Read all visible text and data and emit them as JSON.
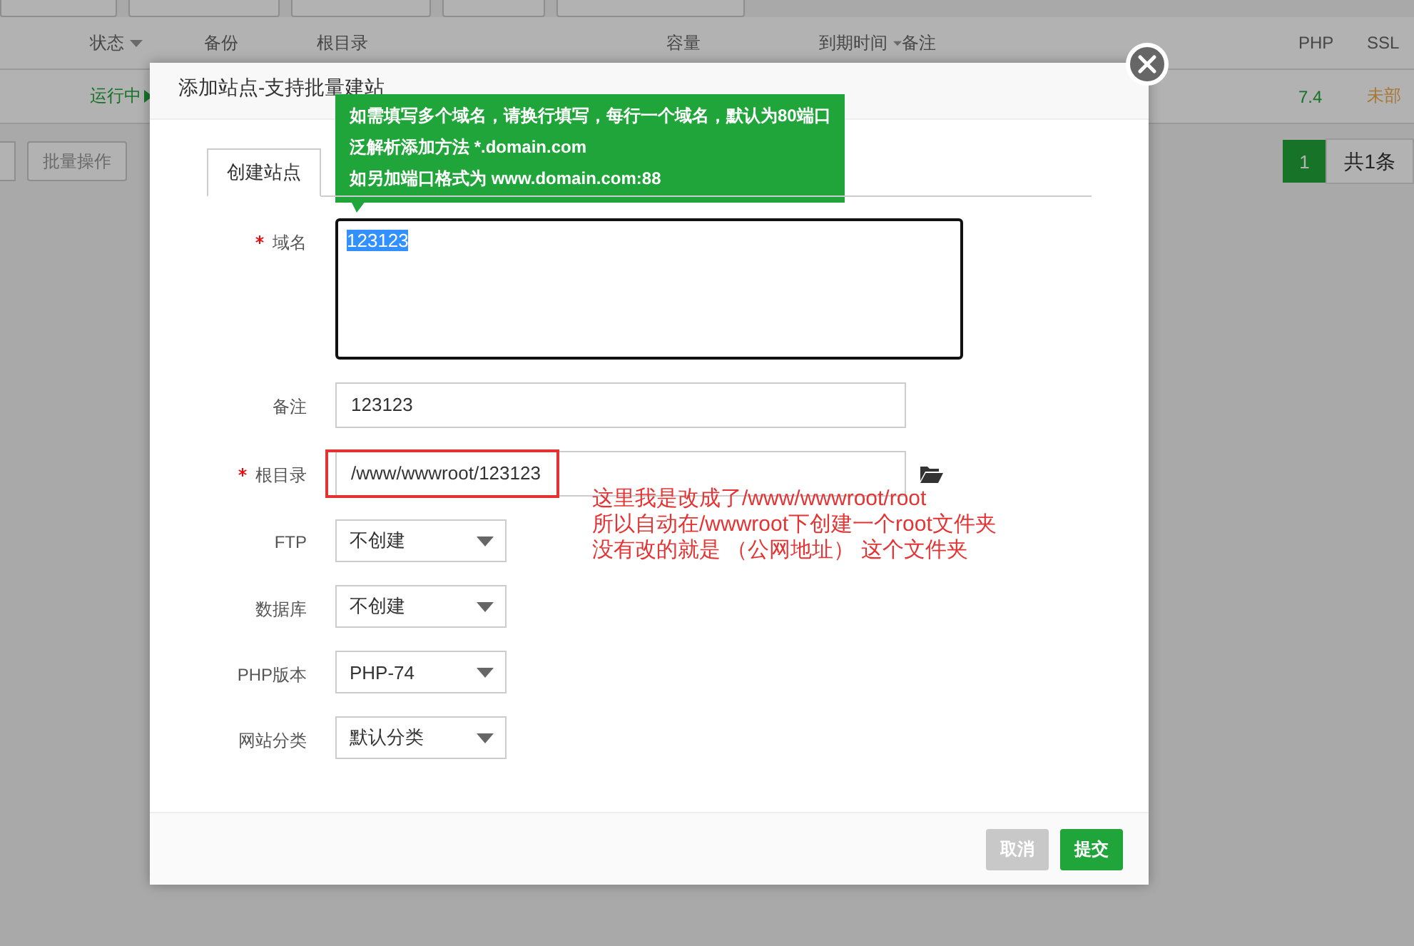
{
  "table": {
    "columns": [
      {
        "label": "状态",
        "sortable": true
      },
      {
        "label": "备份",
        "sortable": false
      },
      {
        "label": "根目录",
        "sortable": false
      },
      {
        "label": "容量",
        "sortable": false
      },
      {
        "label": "到期时间",
        "sortable": true
      },
      {
        "label": "备注",
        "sortable": false
      },
      {
        "label": "PHP",
        "sortable": false
      },
      {
        "label": "SSL",
        "sortable": false
      }
    ],
    "rows": [
      {
        "status": "运行中",
        "php": "7.4",
        "ssl": "未部"
      }
    ]
  },
  "batch_button": "批量操作",
  "pagination": {
    "pages": [
      {
        "label": "1",
        "selected": true
      }
    ],
    "total": "共1条"
  },
  "dialog": {
    "title": "添加站点-支持批量建站",
    "tooltip": [
      "如需填写多个域名，请换行填写，每行一个域名，默认为80端口",
      "泛解析添加方法 *.domain.com",
      "如另加端口格式为 www.domain.com:88"
    ],
    "tabs": [
      {
        "label": "创建站点",
        "selected": true
      }
    ],
    "fields": [
      {
        "kind": "textarea",
        "label": "域名",
        "required": true,
        "value": "123123",
        "focused": true,
        "text_selected": true
      },
      {
        "kind": "input",
        "label": "备注",
        "required": false,
        "value": "123123",
        "focused": false
      },
      {
        "kind": "path",
        "label": "根目录",
        "required": true,
        "value": "/www/wwwroot/123123",
        "focused": false,
        "annotated": true
      },
      {
        "kind": "select",
        "label": "FTP",
        "required": false,
        "value": "不创建"
      },
      {
        "kind": "select",
        "label": "数据库",
        "required": false,
        "value": "不创建"
      },
      {
        "kind": "select",
        "label": "PHP版本",
        "required": false,
        "value": "PHP-74"
      },
      {
        "kind": "select",
        "label": "网站分类",
        "required": false,
        "value": "默认分类"
      }
    ],
    "annotation": [
      "这里我是改成了/www/wwwroot/root",
      "所以自动在/wwwroot下创建一个root文件夹",
      "没有改的就是 （公网地址） 这个文件夹"
    ],
    "buttons": [
      {
        "kind": "cancel",
        "label": "取消"
      },
      {
        "kind": "submit",
        "label": "提交"
      }
    ]
  }
}
